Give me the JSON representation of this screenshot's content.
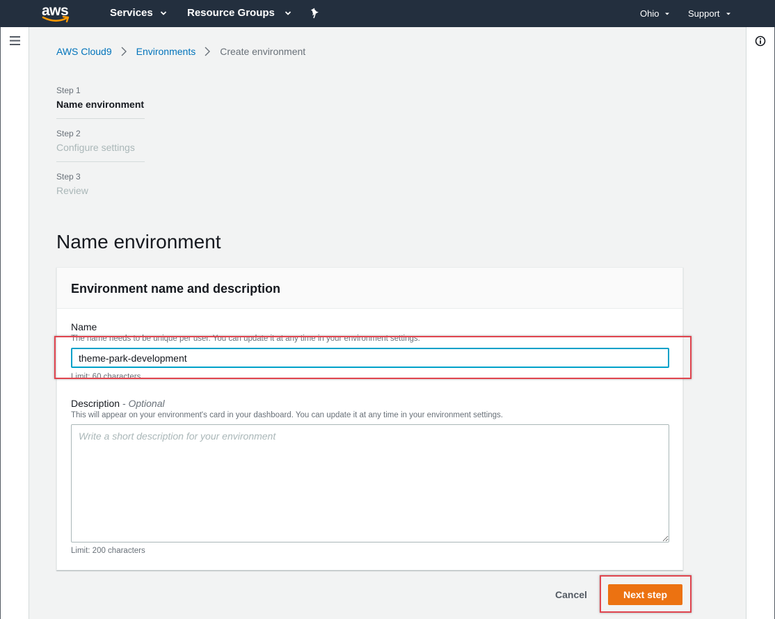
{
  "topnav": {
    "logo_text": "aws",
    "services_label": "Services",
    "resource_groups_label": "Resource Groups",
    "region_label": "Ohio",
    "support_label": "Support"
  },
  "breadcrumb": {
    "items": [
      "AWS Cloud9",
      "Environments"
    ],
    "current": "Create environment"
  },
  "steps": [
    {
      "num": "Step 1",
      "label": "Name environment",
      "active": true
    },
    {
      "num": "Step 2",
      "label": "Configure settings",
      "active": false
    },
    {
      "num": "Step 3",
      "label": "Review",
      "active": false
    }
  ],
  "page": {
    "heading": "Name environment"
  },
  "panel": {
    "title": "Environment name and description",
    "name_label": "Name",
    "name_desc": "The name needs to be unique per user. You can update it at any time in your environment settings.",
    "name_value": "theme-park-development",
    "name_limit": "Limit: 60 characters",
    "description_label": "Description",
    "description_optional": "- Optional",
    "description_desc": "This will appear on your environment's card in your dashboard. You can update it at any time in your environment settings.",
    "description_placeholder": "Write a short description for your environment",
    "description_limit": "Limit: 200 characters"
  },
  "actions": {
    "cancel_label": "Cancel",
    "next_label": "Next step"
  },
  "colors": {
    "nav_bg": "#232f3e",
    "link": "#0073bb",
    "primary_button": "#ec7211",
    "focus_border": "#00a1c9",
    "highlight": "#e0454f"
  }
}
